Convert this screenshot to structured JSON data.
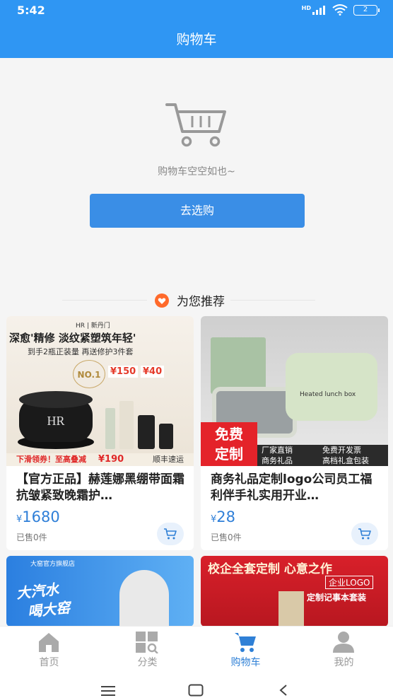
{
  "status": {
    "time": "5:42",
    "network": "HD",
    "battery": "2"
  },
  "header": {
    "title": "购物车"
  },
  "empty": {
    "message": "购物车空空如也~",
    "button_label": "去选购"
  },
  "recommend": {
    "title": "为您推荐"
  },
  "products": [
    {
      "name": "【官方正品】赫莲娜黑绷带面霜抗皱紧致晚霜护…",
      "currency": "¥",
      "price": "1680",
      "sold": "已售0件",
      "banner": {
        "brand": "HR | 新丹门",
        "headline": "深愈'精修 淡纹紧塑筑年轻'",
        "sub": "到手2瓶正装量 再送修护3件套",
        "no1": "NO.1",
        "promo1": "¥150",
        "promo2": "¥40",
        "bottom_left": "下滑领券！至高叠减",
        "bottom_price": "¥190",
        "bottom_right": "顺丰速运"
      }
    },
    {
      "name": "商务礼品定制logo公司员工福利伴手礼实用开业…",
      "currency": "¥",
      "price": "28",
      "sold": "已售0件",
      "banner": {
        "free": "免费",
        "custom": "定制",
        "tag1": "厂家直销",
        "tag2": "免费开发票",
        "tag3": "商务礼品",
        "tag4": "高档礼盒包装",
        "box_label": "Heated lunch box"
      }
    },
    {
      "banner": {
        "store": "大窑官方旗舰店",
        "slogan1": "大汽水",
        "slogan2": "喝大窑"
      }
    },
    {
      "banner": {
        "line1": "校企全套定制 心意之作",
        "line2": "企业LOGO",
        "line3": "定制记事本套装"
      }
    }
  ],
  "tabs": [
    {
      "label": "首页",
      "icon": "home-icon"
    },
    {
      "label": "分类",
      "icon": "category-icon"
    },
    {
      "label": "购物车",
      "icon": "cart-icon"
    },
    {
      "label": "我的",
      "icon": "user-icon"
    }
  ],
  "colors": {
    "primary": "#2f96f3",
    "button": "#3a8ee6",
    "price": "#2f7fd8",
    "accent": "#ff6a2b"
  }
}
